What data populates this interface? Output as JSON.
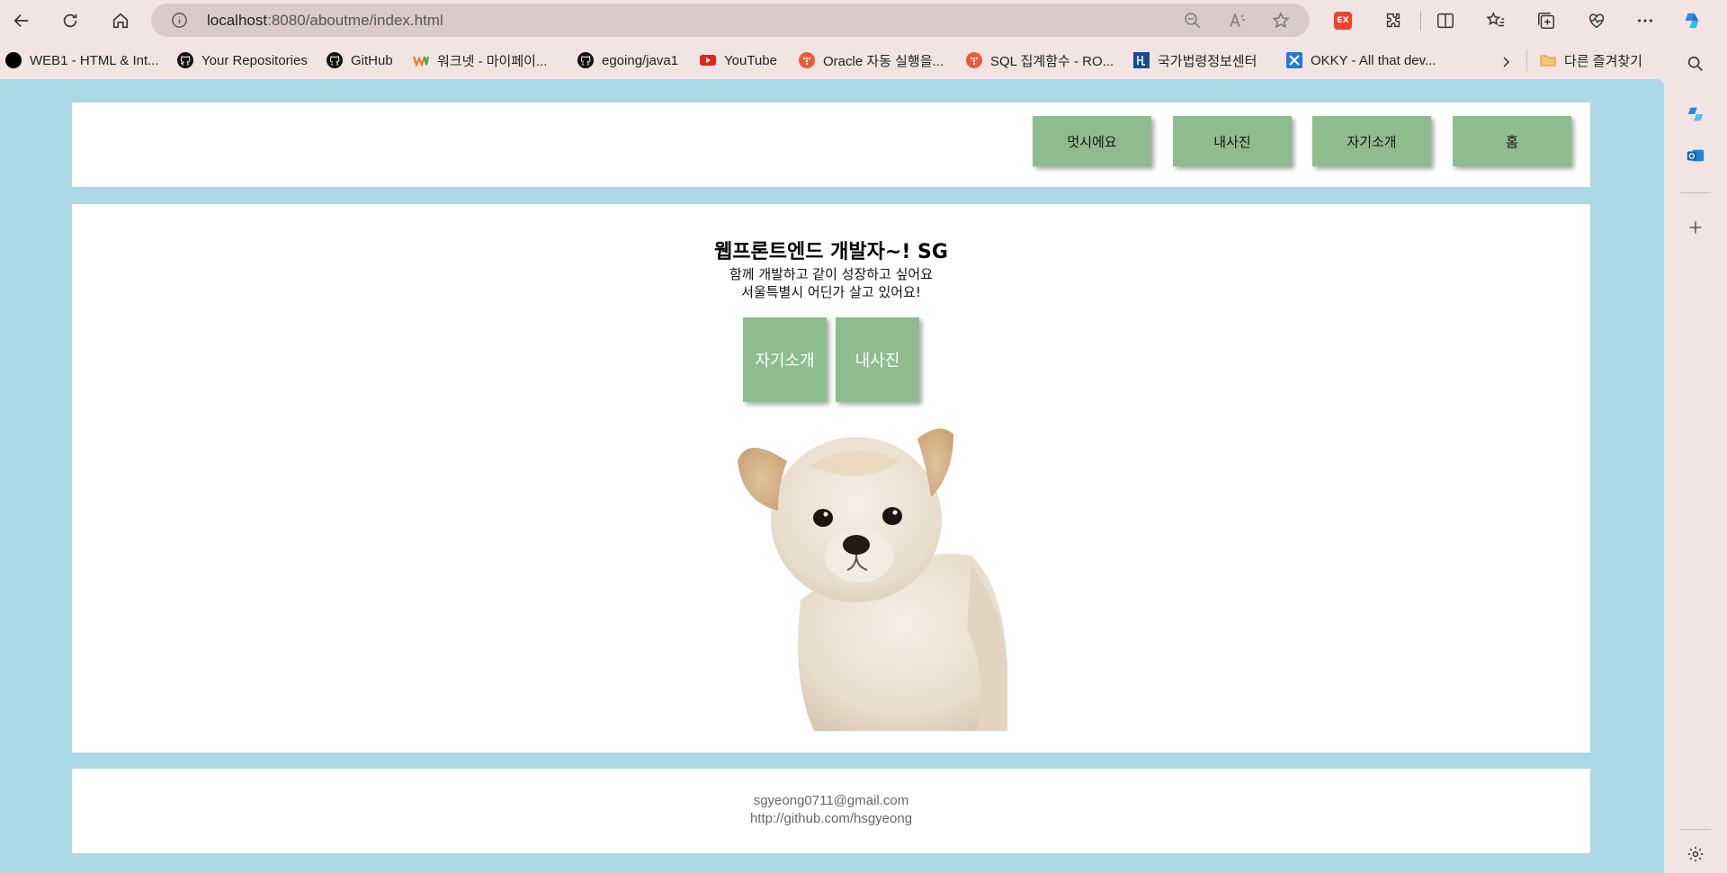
{
  "browser": {
    "url_host": "localhost",
    "url_path": ":8080/aboutme/index.html",
    "bookmarks": [
      {
        "label": "WEB1 - HTML & Int...",
        "icon": "black-circle-icon"
      },
      {
        "label": "Your Repositories",
        "icon": "github-icon"
      },
      {
        "label": "GitHub",
        "icon": "github-icon"
      },
      {
        "label": "워크넷 - 마이페이...",
        "icon": "worknet-icon"
      },
      {
        "label": "egoing/java1",
        "icon": "github-icon"
      },
      {
        "label": "YouTube",
        "icon": "youtube-icon"
      },
      {
        "label": "Oracle 자동 실행을...",
        "icon": "tistory-icon"
      },
      {
        "label": "SQL 집계함수 - RO...",
        "icon": "tistory-icon"
      },
      {
        "label": "국가법령정보센터",
        "icon": "law-icon"
      },
      {
        "label": "OKKY - All that dev...",
        "icon": "okky-icon"
      }
    ],
    "other_bookmarks": "다른 즐겨찾기",
    "extension_badge": "EX"
  },
  "colors": {
    "page_bg": "#add8e6",
    "tile_green": "#8fbc8f",
    "chrome_bg": "#f3e4e4",
    "address_bg": "#dccaca"
  },
  "header": {
    "nav": [
      "멋시에요",
      "내사진",
      "자기소개",
      "홈"
    ]
  },
  "main": {
    "title": "웹프론트엔드 개발자~! SG",
    "line1": "함께 개발하고 같이 성장하고 싶어요",
    "line2": "서울특별시 어딘가 살고 있어요!",
    "buttons": [
      "자기소개",
      "내사진"
    ]
  },
  "footer": {
    "email": "sgyeong0711@gmail.com",
    "github": "http://github.com/hsgyeong"
  }
}
